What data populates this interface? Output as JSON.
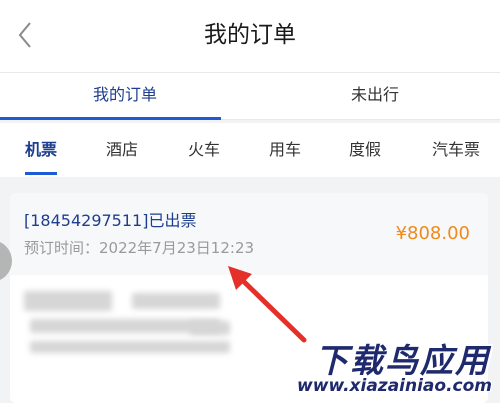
{
  "header": {
    "title": "我的订单",
    "back_icon": "chevron-left-icon"
  },
  "main_tabs": [
    {
      "label": "我的订单",
      "active": true
    },
    {
      "label": "未出行",
      "active": false
    }
  ],
  "category_tabs": [
    {
      "label": "机票",
      "active": true
    },
    {
      "label": "酒店",
      "active": false
    },
    {
      "label": "火车",
      "active": false
    },
    {
      "label": "用车",
      "active": false
    },
    {
      "label": "度假",
      "active": false
    },
    {
      "label": "汽车票",
      "active": false
    }
  ],
  "order": {
    "status": "[18454297511]已出票",
    "time": "预订时间：2022年7月23日12:23",
    "price": "¥808.00"
  },
  "watermark": {
    "title": "下载鸟应用",
    "url": "www.xiazainiao.com"
  },
  "colors": {
    "accent": "#1d5bd6",
    "active_text": "#1d3e8f",
    "price": "#f08a1c",
    "annotation_arrow": "#e5302a"
  }
}
